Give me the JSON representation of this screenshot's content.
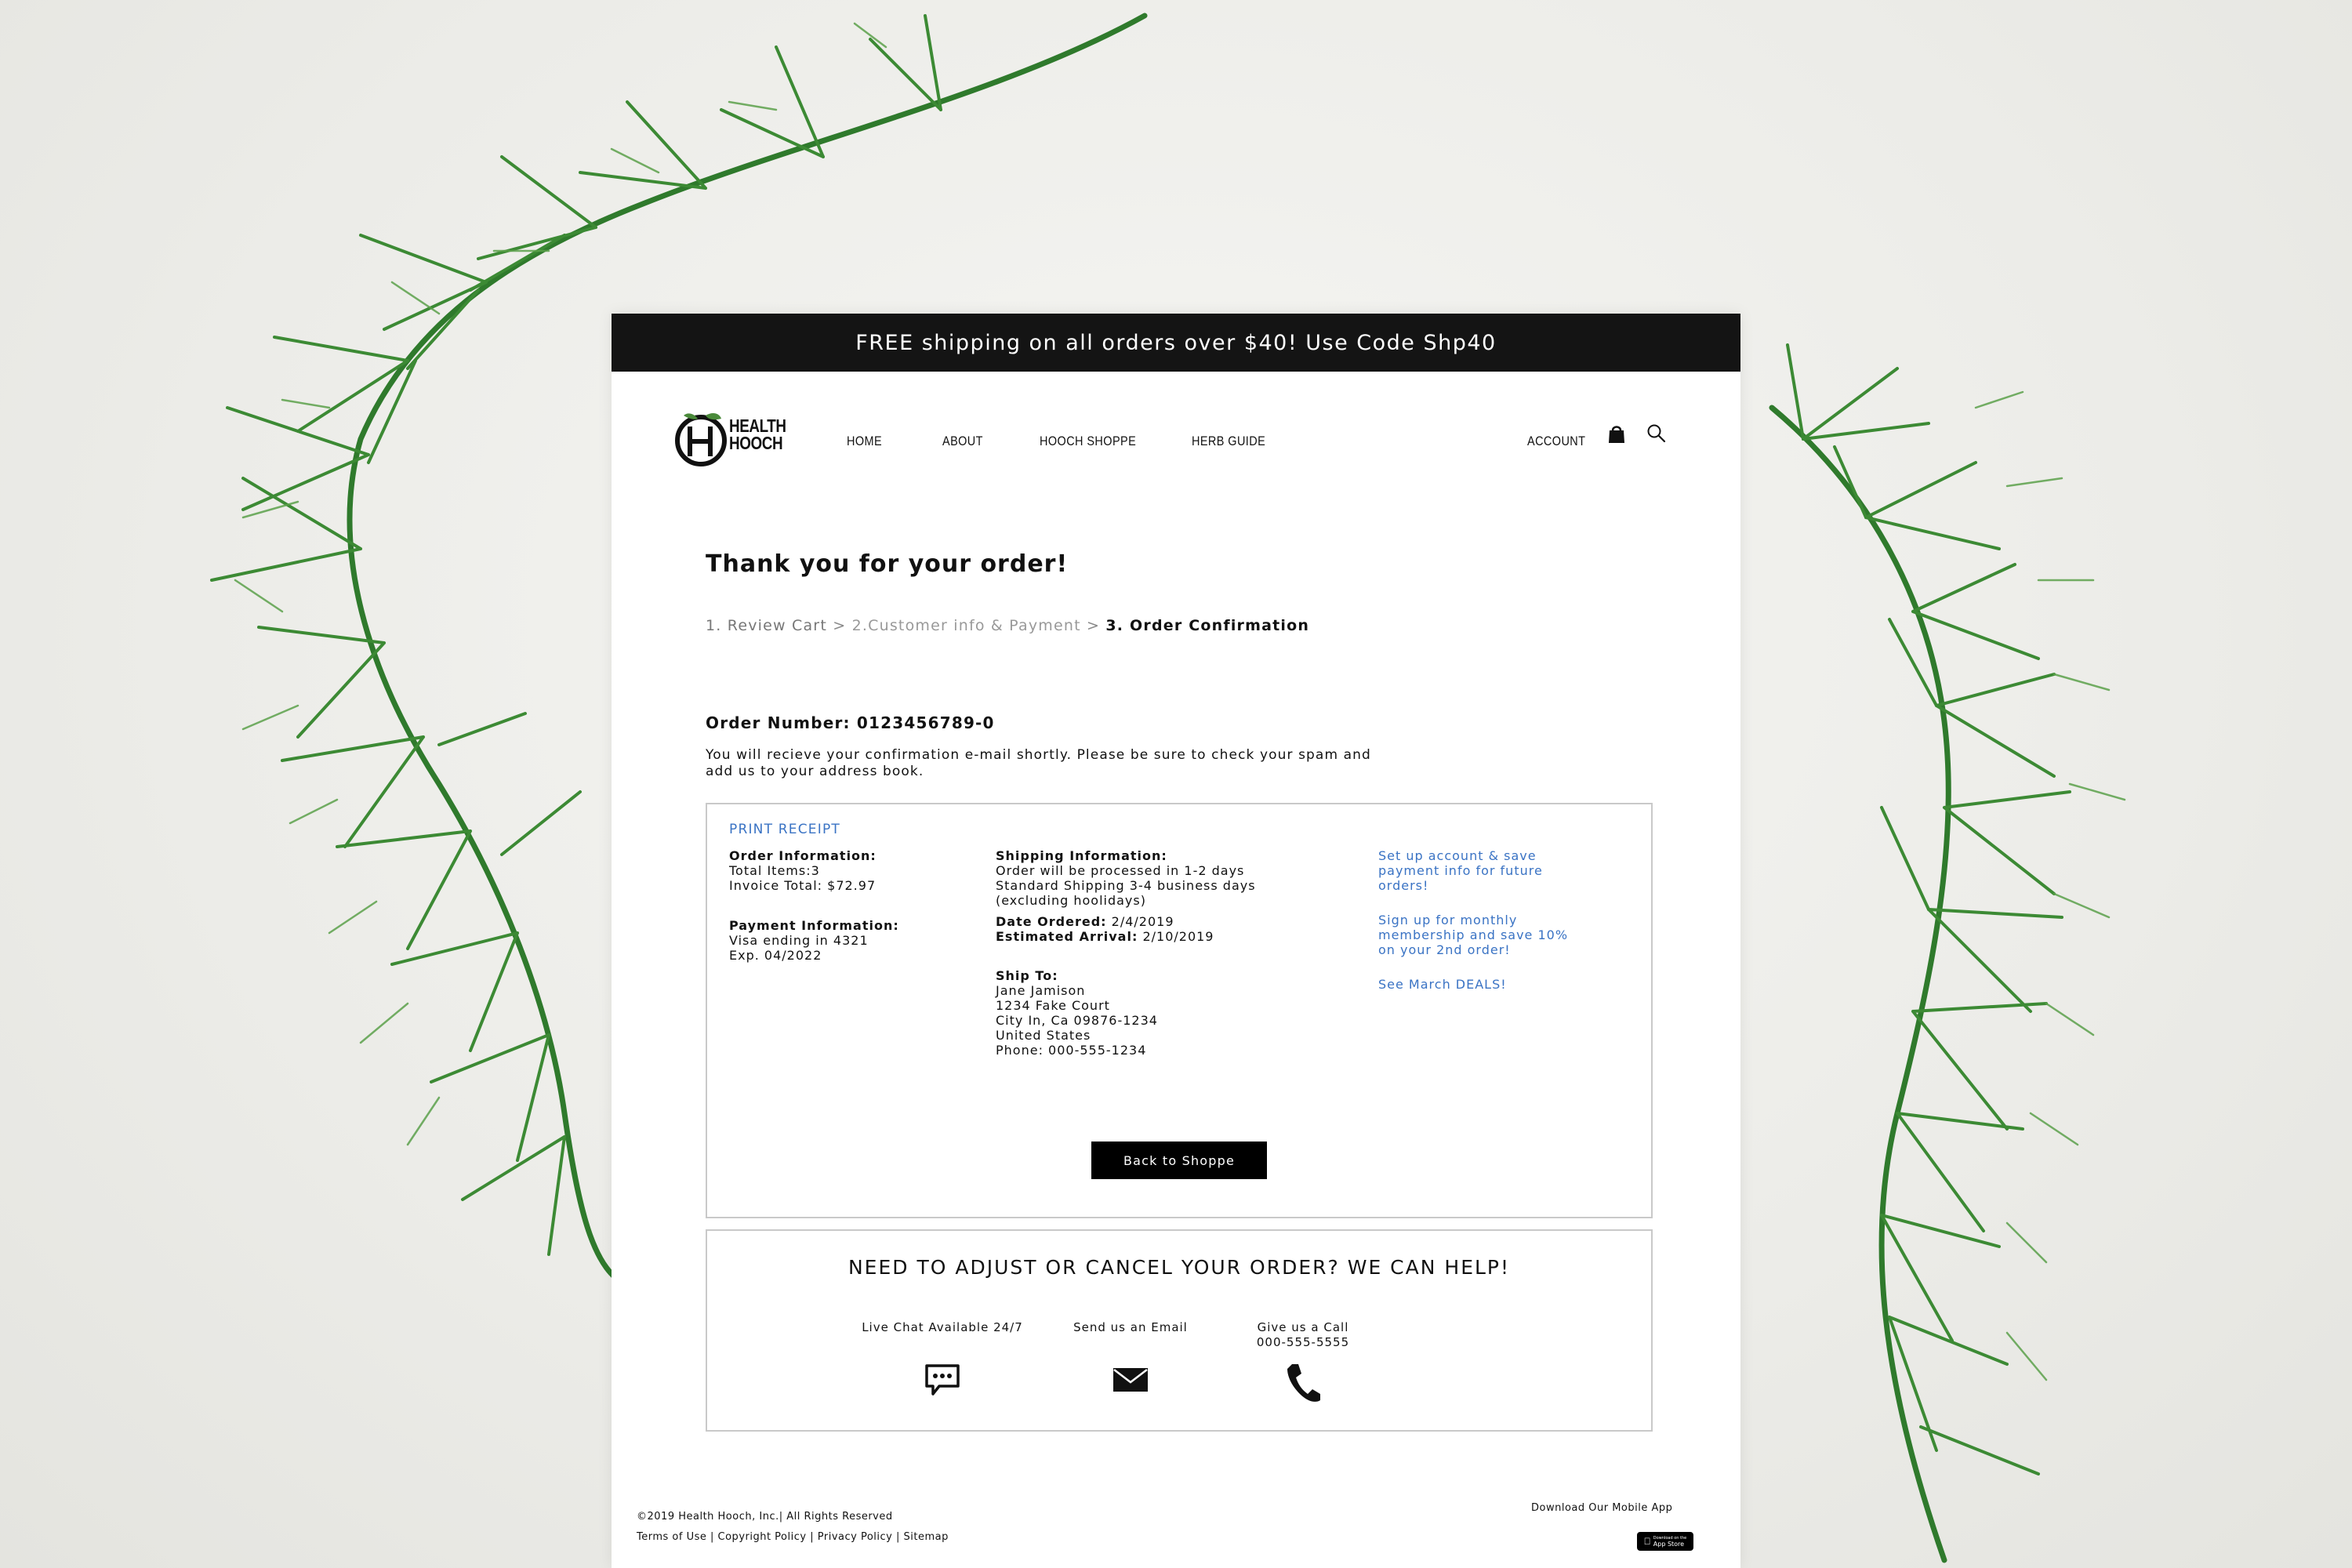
{
  "promo": {
    "text": "FREE shipping on all orders over $40! Use Code Shp40"
  },
  "brand": {
    "line1": "HEALTH",
    "line2": "HOOCH"
  },
  "nav": {
    "items": [
      "HOME",
      "ABOUT",
      "HOOCH SHOPPE",
      "HERB GUIDE"
    ],
    "account": "ACCOUNT",
    "icons": [
      "shopping-bag-icon",
      "search-icon"
    ]
  },
  "page": {
    "title": "Thank you for your order!",
    "breadcrumb": {
      "step1": "1. Review Cart",
      "sep": ">",
      "step2": "2.Customer info & Payment",
      "step3": "3. Order Confirmation"
    },
    "order_number": "Order Number: 0123456789-0",
    "confirm_note": "You will recieve your confirmation e-mail shortly. Please be sure to check your spam and add us to your address book."
  },
  "receipt": {
    "print_label": "PRINT RECEIPT",
    "order_info": {
      "heading": "Order Information:",
      "total_items": "Total Items:3",
      "invoice_total": "Invoice Total: $72.97"
    },
    "payment_info": {
      "heading": "Payment Information:",
      "card": "Visa ending in 4321",
      "exp": "Exp. 04/2022"
    },
    "shipping_info": {
      "heading": "Shipping Information:",
      "line1": "Order will be processed in 1-2 days",
      "line2": "Standard Shipping 3-4 business days",
      "line3": "(excluding hoolidays)",
      "date_ordered_label": "Date Ordered:",
      "date_ordered": "2/4/2019",
      "estimated_label": "Estimated Arrival:",
      "estimated": "2/10/2019"
    },
    "ship_to": {
      "heading": "Ship To:",
      "name": "Jane Jamison",
      "street": "1234 Fake Court",
      "city": "City In, Ca 09876-1234",
      "country": "United States",
      "phone": "Phone: 000-555-1234"
    },
    "promo_links": {
      "account": "Set up account & save payment info for future orders!",
      "membership": "Sign up for monthly membership and save 10% on your 2nd order!",
      "deals": "See March DEALS!"
    },
    "back_button": "Back to Shoppe"
  },
  "help": {
    "title": "NEED TO ADJUST OR CANCEL YOUR ORDER? WE CAN HELP!",
    "chat_label": "Live Chat Available 24/7",
    "email_label": "Send us an Email",
    "call_label": "Give us a Call",
    "call_number": "000-555-5555",
    "icons": [
      "chat-icon",
      "envelope-icon",
      "phone-icon"
    ]
  },
  "footer": {
    "copyright": "©2019 Health Hooch, Inc.|  All Rights Reserved",
    "links": [
      "Terms of Use",
      "Copyright Policy",
      "Privacy Policy",
      "Sitemap"
    ],
    "separator": " | ",
    "download": "Download Our Mobile App",
    "badge_small": "Download on the",
    "badge_big": "App Store"
  },
  "colors": {
    "promo_bar": "#141414",
    "link_blue": "#3a73c4",
    "border": "#c9c9c9",
    "button": "#000000"
  }
}
